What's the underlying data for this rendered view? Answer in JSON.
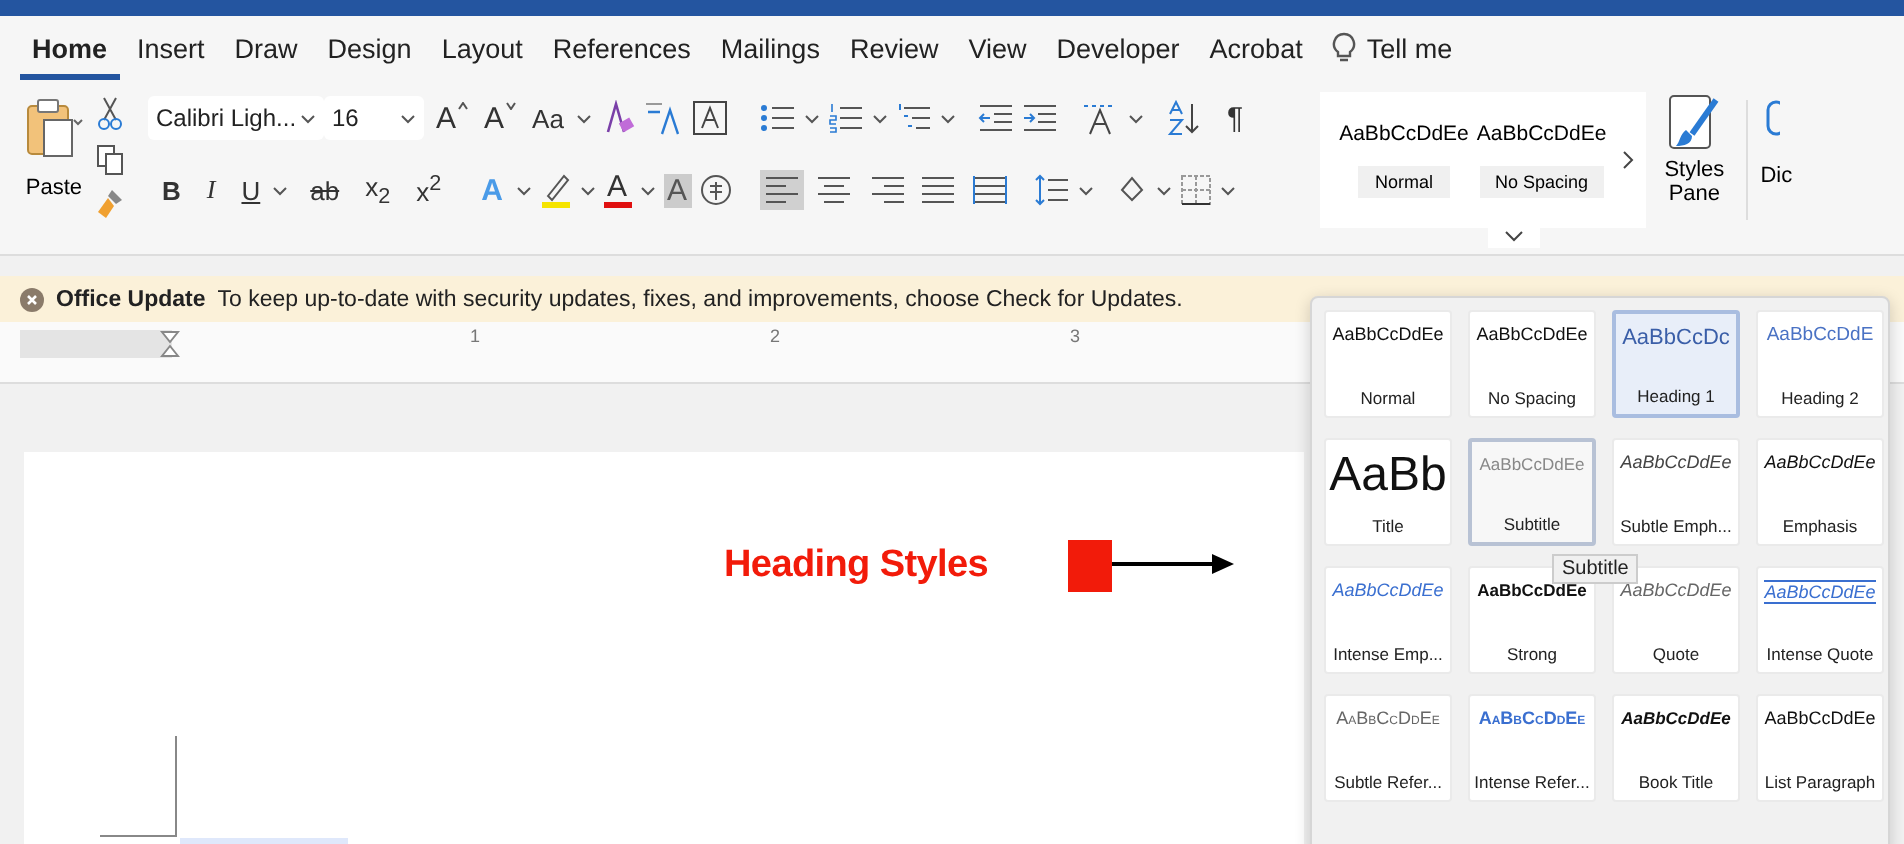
{
  "tabs": [
    {
      "label": "Home",
      "selected": true
    },
    {
      "label": "Insert",
      "selected": false
    },
    {
      "label": "Draw",
      "selected": false
    },
    {
      "label": "Design",
      "selected": false
    },
    {
      "label": "Layout",
      "selected": false
    },
    {
      "label": "References",
      "selected": false
    },
    {
      "label": "Mailings",
      "selected": false
    },
    {
      "label": "Review",
      "selected": false
    },
    {
      "label": "View",
      "selected": false
    },
    {
      "label": "Developer",
      "selected": false
    },
    {
      "label": "Acrobat",
      "selected": false
    }
  ],
  "tell_me": "Tell me",
  "ribbon": {
    "paste_label": "Paste",
    "font_name": "Calibri Ligh...",
    "font_size": "16",
    "grow_font": "A",
    "shrink_font": "A",
    "change_case": "Aa",
    "format_buttons": [
      {
        "label": "B",
        "kind": "bold"
      },
      {
        "label": "I",
        "kind": "italic"
      },
      {
        "label": "U",
        "kind": "underline"
      },
      {
        "label": "ab",
        "kind": "strike"
      },
      {
        "label": "x$_{2}$",
        "kind": "plain"
      },
      {
        "label": "x$^{2}$",
        "kind": "plain"
      }
    ],
    "color_buttons": [
      {
        "label": "A",
        "kind": "effects"
      },
      {
        "label": "A",
        "kind": "font-color"
      },
      {
        "label": "A",
        "kind": "shading"
      }
    ],
    "alignment": [
      {
        "kind": "left",
        "selected": true
      },
      {
        "kind": "center",
        "selected": false
      },
      {
        "kind": "right",
        "selected": false
      },
      {
        "kind": "justify",
        "selected": false
      },
      {
        "kind": "distributed",
        "selected": false
      }
    ],
    "pilcrow": "¶",
    "quick_styles": [
      {
        "preview": "AaBbCcDdEe",
        "label": "Normal"
      },
      {
        "preview": "AaBbCcDdEe",
        "label": "No Spacing"
      }
    ],
    "styles_pane": "Styles Pane",
    "cut_button": "Dic"
  },
  "update_bar": {
    "title": "Office Update",
    "message": "To keep up-to-date with security updates, fixes, and improvements, choose Check for Updates."
  },
  "ruler": [
    "1",
    "2",
    "3"
  ],
  "annotation": {
    "text": "Heading Styles"
  },
  "gallery": [
    {
      "preview": "AaBbCcDdEe",
      "label": "Normal",
      "kind": "normal",
      "selected": false,
      "hovered": false
    },
    {
      "preview": "AaBbCcDdEe",
      "label": "No Spacing",
      "kind": "normal",
      "selected": false,
      "hovered": false
    },
    {
      "preview": "AaBbCcDc",
      "label": "Heading 1",
      "kind": "heading1",
      "selected": true,
      "hovered": false
    },
    {
      "preview": "AaBbCcDdE",
      "label": "Heading 2",
      "kind": "heading2",
      "selected": false,
      "hovered": false
    },
    {
      "preview": "AaBb",
      "label": "Title",
      "kind": "title",
      "selected": false,
      "hovered": false
    },
    {
      "preview": "AaBbCcDdEe",
      "label": "Subtitle",
      "kind": "subtitle",
      "selected": false,
      "hovered": true
    },
    {
      "preview": "AaBbCcDdEe",
      "label": "Subtle Emph...",
      "kind": "subtle-emphasis",
      "selected": false,
      "hovered": false
    },
    {
      "preview": "AaBbCcDdEe",
      "label": "Emphasis",
      "kind": "emphasis",
      "selected": false,
      "hovered": false
    },
    {
      "preview": "AaBbCcDdEe",
      "label": "Intense Emp...",
      "kind": "intense-emphasis",
      "selected": false,
      "hovered": false
    },
    {
      "preview": "AaBbCcDdEe",
      "label": "Strong",
      "kind": "strong",
      "selected": false,
      "hovered": false
    },
    {
      "preview": "AaBbCcDdEe",
      "label": "Quote",
      "kind": "quote",
      "selected": false,
      "hovered": false
    },
    {
      "preview": "AaBbCcDdEe",
      "label": "Intense Quote",
      "kind": "intense-quote",
      "selected": false,
      "hovered": false
    },
    {
      "preview": "AaBbCcDdEe",
      "label": "Subtle Refer...",
      "kind": "subtle-reference",
      "selected": false,
      "hovered": false
    },
    {
      "preview": "AaBbCcDdEe",
      "label": "Intense Refer...",
      "kind": "intense-reference",
      "selected": false,
      "hovered": false
    },
    {
      "preview": "AaBbCcDdEe",
      "label": "Book Title",
      "kind": "book-title",
      "selected": false,
      "hovered": false
    },
    {
      "preview": "AaBbCcDdEe",
      "label": "List Paragraph",
      "kind": "normal",
      "selected": false,
      "hovered": false
    }
  ],
  "tooltip": "Subtitle"
}
